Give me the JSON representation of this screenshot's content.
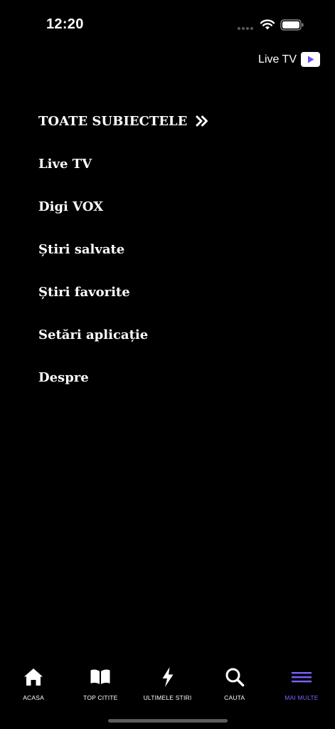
{
  "status_bar": {
    "time": "12:20"
  },
  "header": {
    "live_tv_label": "Live TV"
  },
  "menu": {
    "items": [
      {
        "label": "TOATE SUBIECTELE"
      },
      {
        "label": "Live TV"
      },
      {
        "label": "Digi VOX"
      },
      {
        "label": "Știri salvate"
      },
      {
        "label": "Știri favorite"
      },
      {
        "label": "Setări aplicație"
      },
      {
        "label": "Despre"
      }
    ]
  },
  "tab_bar": {
    "items": [
      {
        "label": "ACASA",
        "icon": "home-icon"
      },
      {
        "label": "TOP CITITE",
        "icon": "book-icon"
      },
      {
        "label": "ULTIMELE STIRI",
        "icon": "lightning-icon"
      },
      {
        "label": "CAUTA",
        "icon": "search-icon"
      },
      {
        "label": "MAI MULTE",
        "icon": "menu-icon",
        "active": true
      }
    ]
  },
  "colors": {
    "background": "#000000",
    "text": "#ffffff",
    "accent": "#7b61ff"
  }
}
